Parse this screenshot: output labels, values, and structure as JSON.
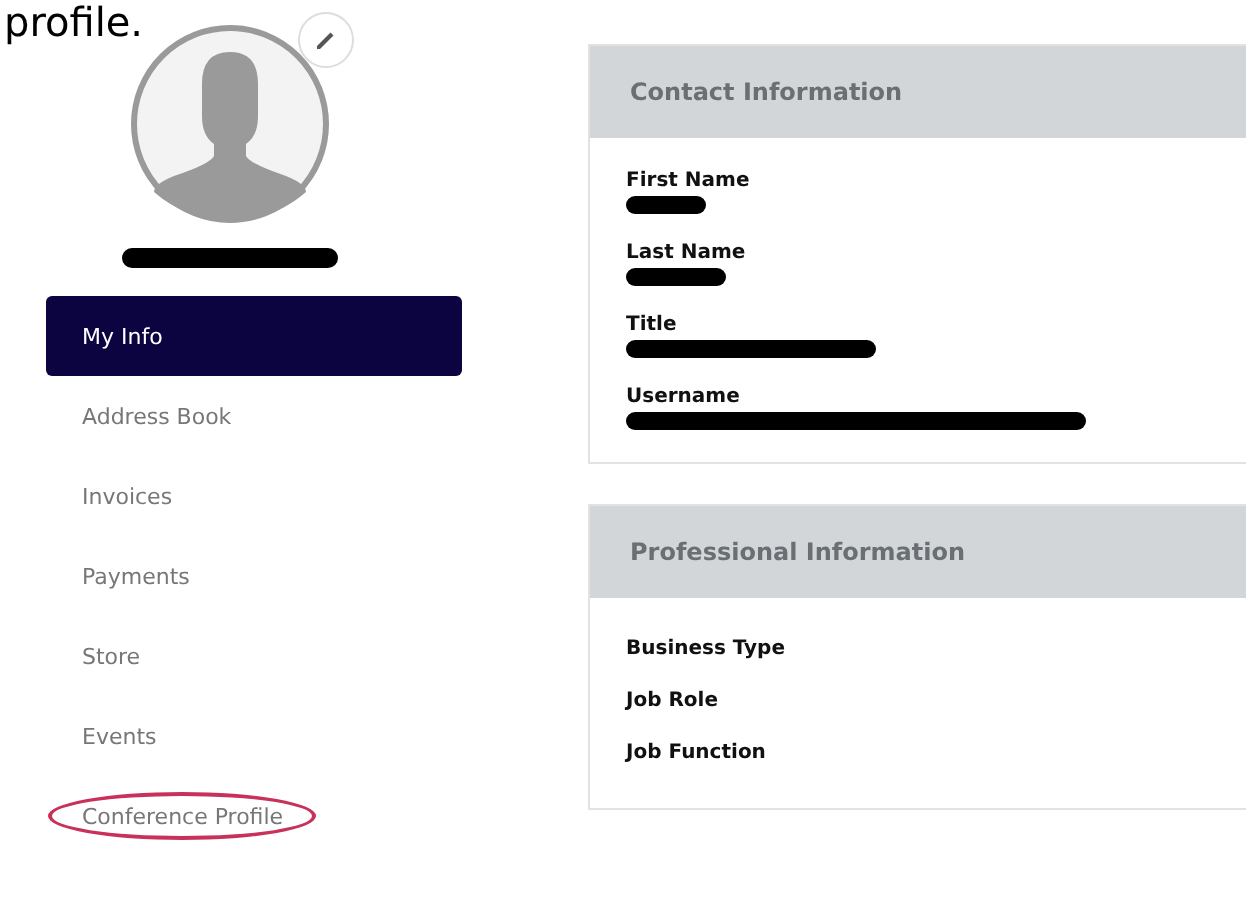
{
  "page_heading": "profile.",
  "profile": {
    "name_redacted": true
  },
  "nav": [
    {
      "label": "My Info",
      "selected": true,
      "circled": false
    },
    {
      "label": "Address Book",
      "selected": false,
      "circled": false
    },
    {
      "label": "Invoices",
      "selected": false,
      "circled": false
    },
    {
      "label": "Payments",
      "selected": false,
      "circled": false
    },
    {
      "label": "Store",
      "selected": false,
      "circled": false
    },
    {
      "label": "Events",
      "selected": false,
      "circled": false
    },
    {
      "label": "Conference Profile",
      "selected": false,
      "circled": true
    }
  ],
  "cards": [
    {
      "title": "Contact Information",
      "fields": [
        {
          "label": "First Name",
          "redacted": true
        },
        {
          "label": "Last Name",
          "redacted": true
        },
        {
          "label": "Title",
          "redacted": true
        },
        {
          "label": "Username",
          "redacted": true
        }
      ]
    },
    {
      "title": "Professional Information",
      "fields": [
        {
          "label": "Business Type",
          "redacted": false
        },
        {
          "label": "Job Role",
          "redacted": false
        },
        {
          "label": "Job Function",
          "redacted": false
        }
      ]
    }
  ]
}
